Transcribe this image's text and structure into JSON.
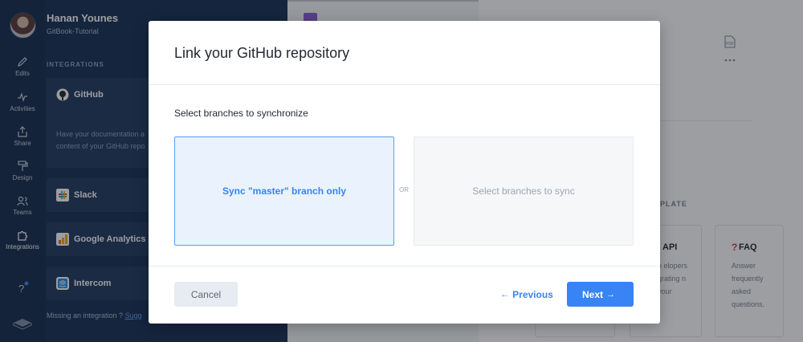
{
  "user": {
    "name": "Hanan Younes",
    "space": "GitBook-Tutorial"
  },
  "rail": {
    "items": [
      {
        "label": "Edits",
        "icon": "pencil-icon"
      },
      {
        "label": "Activities",
        "icon": "activity-icon"
      },
      {
        "label": "Share",
        "icon": "share-icon"
      },
      {
        "label": "Design",
        "icon": "paint-roller-icon"
      },
      {
        "label": "Teams",
        "icon": "teams-icon"
      },
      {
        "label": "Integrations",
        "icon": "puzzle-icon"
      }
    ],
    "help_icon": "help-icon",
    "logo_icon": "gitbook-logo-icon"
  },
  "integrations": {
    "section_label": "INTEGRATIONS",
    "items": [
      {
        "name": "GitHub",
        "description": "Have your documentation a content of your GitHub repo",
        "icon": "github-icon"
      },
      {
        "name": "Slack",
        "icon": "slack-icon"
      },
      {
        "name": "Google Analytics",
        "icon": "google-analytics-icon"
      },
      {
        "name": "Intercom",
        "icon": "intercom-icon"
      }
    ],
    "missing_text": "Missing an integration ?",
    "missing_link": "Sugg"
  },
  "background": {
    "pdf_icon": "pdf-icon",
    "more_icon": "more-icon",
    "template_label": "PLATE",
    "cards": [
      {
        "title": "API",
        "description": "o elopers grating n your"
      },
      {
        "title": "FAQ",
        "description": "Answer frequently asked questions."
      }
    ]
  },
  "modal": {
    "title": "Link your GitHub repository",
    "section_title": "Select branches to synchronize",
    "options": [
      {
        "label": "Sync \"master\" branch only",
        "selected": true
      },
      {
        "label": "Select branches to sync",
        "selected": false
      }
    ],
    "or_label": "OR",
    "cancel_label": "Cancel",
    "previous_label": "Previous",
    "next_label": "Next"
  },
  "colors": {
    "accent": "#3884f4",
    "sidebar": "#183055",
    "rail": "#162b4d"
  }
}
